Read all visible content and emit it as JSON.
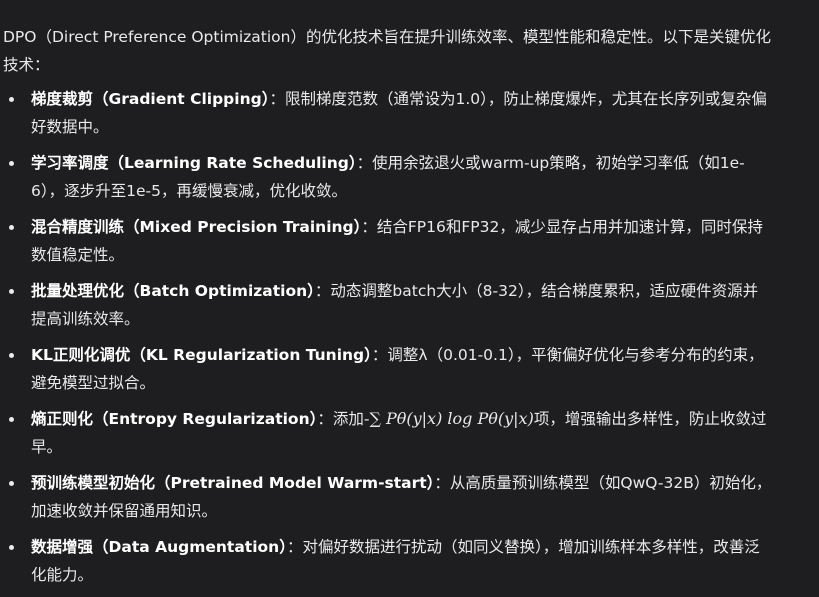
{
  "intro": "DPO（Direct Preference Optimization）的优化技术旨在提升训练效率、模型性能和稳定性。以下是关键优化技术：",
  "items": [
    {
      "term": "梯度裁剪（Gradient Clipping）",
      "desc": "：限制梯度范数（通常设为1.0），防止梯度爆炸，尤其在长序列或复杂偏好数据中。"
    },
    {
      "term": "学习率调度（Learning Rate Scheduling）",
      "desc": "：使用余弦退火或warm-up策略，初始学习率低（如1e-6），逐步升至1e-5，再缓慢衰减，优化收敛。"
    },
    {
      "term": "混合精度训练（Mixed Precision Training）",
      "desc": "：结合FP16和FP32，减少显存占用并加速计算，同时保持数值稳定性。"
    },
    {
      "term": "批量处理优化（Batch Optimization）",
      "desc": "：动态调整batch大小（8-32），结合梯度累积，适应硬件资源并提高训练效率。"
    },
    {
      "term": "KL正则化调优（KL Regularization Tuning）",
      "desc": "：调整λ（0.01-0.1），平衡偏好优化与参考分布的约束，避免模型过拟合。"
    },
    {
      "term": "熵正则化（Entropy Regularization）",
      "desc_before": "：添加-",
      "formula": "∑ Pθ(y|x) log Pθ(y|x)",
      "desc_after": "项，增强输出多样性，防止收敛过早。"
    },
    {
      "term": "预训练模型初始化（Pretrained Model Warm-start）",
      "desc": "：从高质量预训练模型（如QwQ-32B）初始化，加速收敛并保留通用知识。"
    },
    {
      "term": "数据增强（Data Augmentation）",
      "desc": "：对偏好数据进行扰动（如同义替换），增加训练样本多样性，改善泛化能力。"
    }
  ]
}
